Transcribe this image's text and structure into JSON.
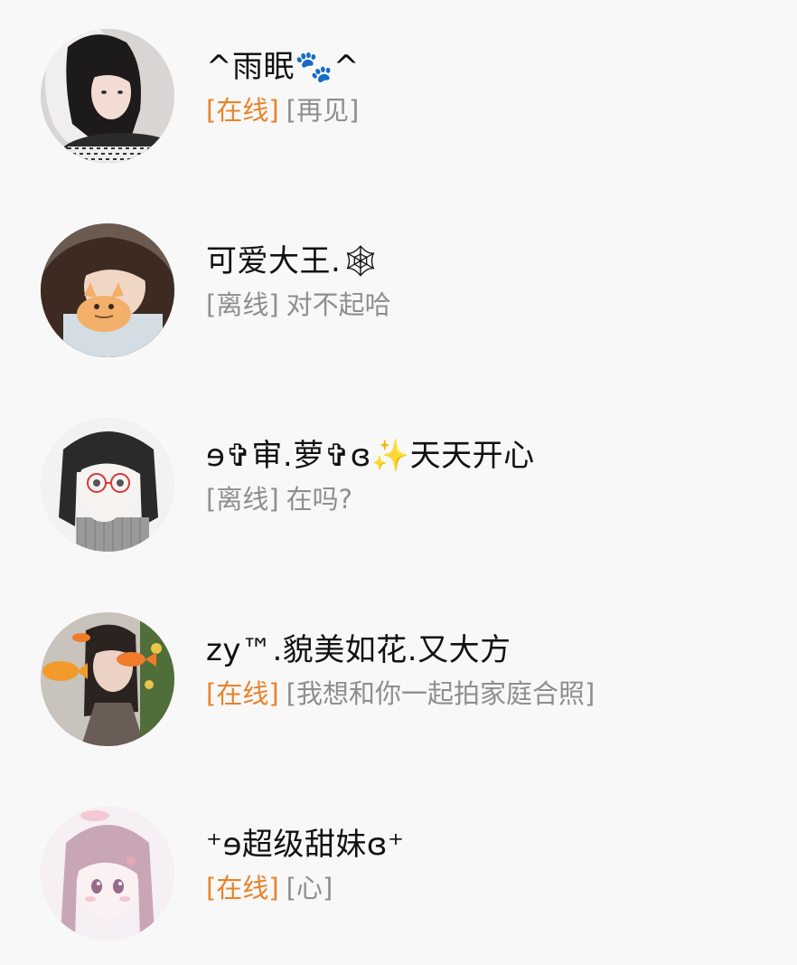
{
  "contacts": [
    {
      "name": "^雨眠🐾^",
      "status": "[在线]",
      "status_state": "online",
      "message": "[再见]",
      "avatar_icon": "girl-with-pillow-avatar"
    },
    {
      "name": "可爱大王.🕸",
      "status": "[离线]",
      "status_state": "offline",
      "message": "对不起哈",
      "avatar_icon": "girl-with-kitten-avatar"
    },
    {
      "name": "ɘ✞审.萝✞ɞ✨天天开心",
      "status": "[离线]",
      "status_state": "offline",
      "message": "在吗?",
      "avatar_icon": "anime-girl-glasses-avatar"
    },
    {
      "name": "zy™.貌美如花.又大方",
      "status": "[在线]",
      "status_state": "online",
      "message": "[我想和你一起拍家庭合照]",
      "avatar_icon": "girl-with-goldfish-avatar"
    },
    {
      "name": "⁺ɘ超级甜妹ɞ⁺",
      "status": "[在线]",
      "status_state": "online",
      "message": "[心]",
      "avatar_icon": "anime-girl-pink-avatar"
    }
  ],
  "colors": {
    "online": "#e8832b",
    "offline": "#8e8e8e",
    "name": "#111111",
    "background": "#f8f8f8"
  }
}
